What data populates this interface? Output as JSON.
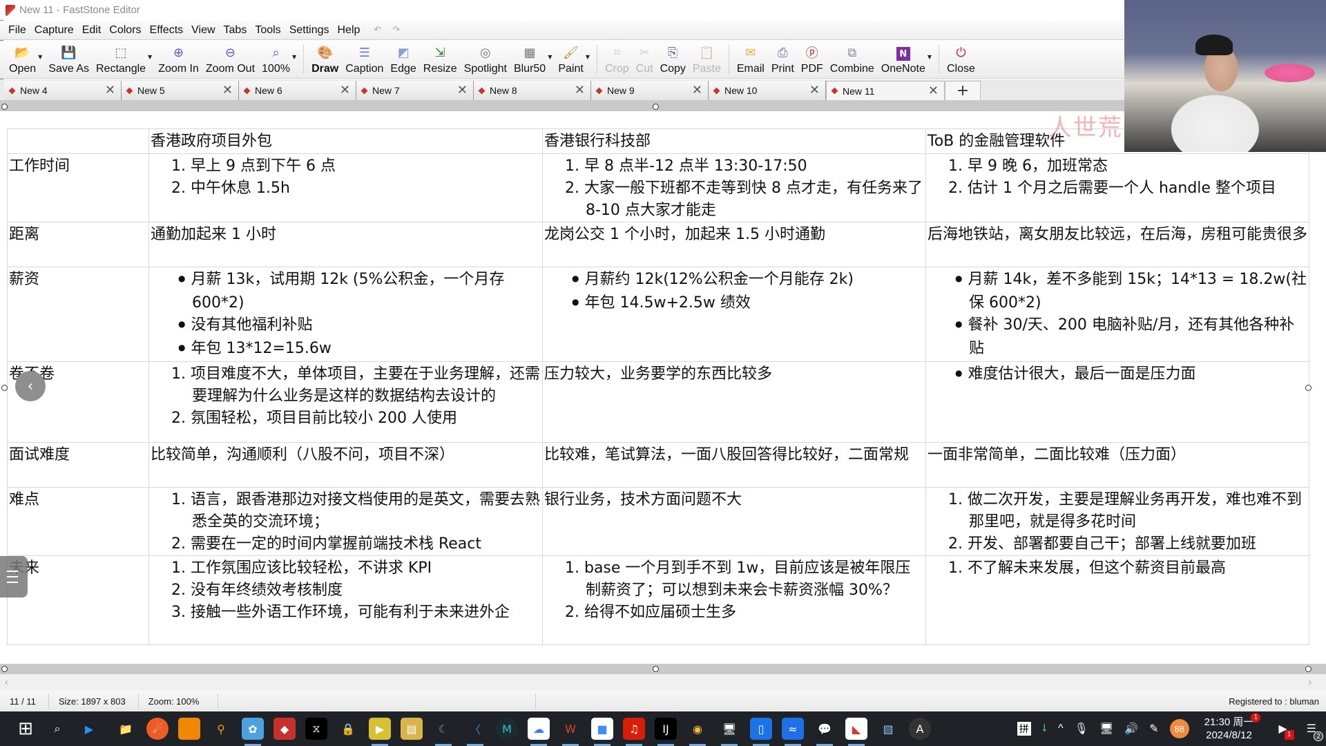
{
  "window": {
    "title": "New 11 - FastStone Editor"
  },
  "menu": {
    "items": [
      "File",
      "Capture",
      "Edit",
      "Colors",
      "Effects",
      "View",
      "Tabs",
      "Tools",
      "Settings",
      "Help"
    ],
    "undo_redo": "↶ ↷"
  },
  "toolbar": {
    "items": [
      {
        "label": "Open",
        "icon": "folder-open-icon",
        "glyph": "📂",
        "dropdown": true
      },
      {
        "label": "Save As",
        "icon": "floppy-disk-icon",
        "glyph": "💾"
      },
      {
        "label": "Rectangle",
        "icon": "rectangle-select-icon",
        "glyph": "⬚",
        "dropdown": true
      },
      {
        "label": "Zoom In",
        "icon": "zoom-in-icon",
        "glyph": "⊕"
      },
      {
        "label": "Zoom Out",
        "icon": "zoom-out-icon",
        "glyph": "⊖"
      },
      {
        "label": "100%",
        "icon": "magnifier-icon",
        "glyph": "⌕",
        "dropdown": true
      },
      {
        "label": "Draw",
        "icon": "draw-palette-icon",
        "glyph": "🎨",
        "bold": true
      },
      {
        "label": "Caption",
        "icon": "caption-icon",
        "glyph": "☰"
      },
      {
        "label": "Edge",
        "icon": "edge-effect-icon",
        "glyph": "◩"
      },
      {
        "label": "Resize",
        "icon": "resize-icon",
        "glyph": "⇲"
      },
      {
        "label": "Spotlight",
        "icon": "spotlight-icon",
        "glyph": "◎"
      },
      {
        "label": "Blur50",
        "icon": "blur-icon",
        "glyph": "▦",
        "dropdown": true
      },
      {
        "label": "Paint",
        "icon": "paint-icon",
        "glyph": "🖌",
        "dropdown": true
      },
      {
        "label": "Crop",
        "icon": "crop-icon",
        "glyph": "⌗",
        "disabled": true
      },
      {
        "label": "Cut",
        "icon": "scissors-icon",
        "glyph": "✂",
        "disabled": true
      },
      {
        "label": "Copy",
        "icon": "copy-icon",
        "glyph": "⎘"
      },
      {
        "label": "Paste",
        "icon": "paste-icon",
        "glyph": "📋",
        "disabled": true
      },
      {
        "label": "Email",
        "icon": "envelope-icon",
        "glyph": "✉"
      },
      {
        "label": "Print",
        "icon": "printer-icon",
        "glyph": "⎙"
      },
      {
        "label": "PDF",
        "icon": "pdf-icon",
        "glyph": "ⓟ"
      },
      {
        "label": "Combine",
        "icon": "combine-icon",
        "glyph": "⧉"
      },
      {
        "label": "OneNote",
        "icon": "onenote-icon",
        "glyph": "N",
        "dropdown": true
      },
      {
        "label": "Close",
        "icon": "power-icon",
        "glyph": "⏻"
      }
    ]
  },
  "tabs": {
    "items": [
      "New 4",
      "New 5",
      "New 6",
      "New 7",
      "New 8",
      "New 9",
      "New 10",
      "New 11"
    ],
    "active": "New 11",
    "add_label": "+",
    "close_glyph": "✕"
  },
  "watermark": "人世荒",
  "table": {
    "headers": [
      "",
      "香港政府项目外包",
      "香港银行科技部",
      "ToB 的金融管理软件"
    ],
    "rows": [
      {
        "label": "工作时间",
        "cells": [
          {
            "type": "ol",
            "items": [
              "早上 9 点到下午 6 点",
              "中午休息 1.5h"
            ]
          },
          {
            "type": "ol",
            "items": [
              "早 8 点半-12 点半 13:30-17:50",
              "大家一般下班都不走等到快 8 点才走，有任务来了 8-10 点大家才能走"
            ]
          },
          {
            "type": "ol",
            "items": [
              "早 9 晚 6，加班常态",
              "估计 1 个月之后需要一个人 handle 整个项目"
            ]
          }
        ]
      },
      {
        "label": "距离",
        "cells": [
          {
            "type": "text",
            "text": "通勤加起来 1 小时"
          },
          {
            "type": "text",
            "text": "龙岗公交 1 个小时，加起来 1.5 小时通勤"
          },
          {
            "type": "text",
            "text": "后海地铁站，离女朋友比较远，在后海，房租可能贵很多"
          }
        ]
      },
      {
        "label": "薪资",
        "cells": [
          {
            "type": "ul",
            "items": [
              "月薪 13k，试用期 12k (5%公积金，一个月存 600*2)",
              "没有其他福利补贴",
              "年包 13*12=15.6w"
            ]
          },
          {
            "type": "ul",
            "items": [
              "月薪约 12k(12%公积金一个月能存 2k)",
              "年包 14.5w+2.5w 绩效"
            ]
          },
          {
            "type": "ul",
            "items": [
              "月薪 14k，差不多能到 15k；14*13 = 18.2w(社保 600*2)",
              "餐补 30/天、200 电脑补贴/月，还有其他各种补贴"
            ]
          }
        ]
      },
      {
        "label": "卷不卷",
        "cells": [
          {
            "type": "ol",
            "items": [
              "项目难度不大，单体项目，主要在于业务理解，还需要理解为什么业务是这样的数据结构去设计的",
              "氛围轻松，项目目前比较小 200 人使用"
            ]
          },
          {
            "type": "text",
            "text": "压力较大，业务要学的东西比较多"
          },
          {
            "type": "ul",
            "items": [
              "难度估计很大，最后一面是压力面"
            ]
          }
        ]
      },
      {
        "label": "面试难度",
        "cells": [
          {
            "type": "text",
            "text": "比较简单，沟通顺利（八股不问，项目不深）"
          },
          {
            "type": "text",
            "text": "比较难，笔试算法，一面八股回答得比较好，二面常规"
          },
          {
            "type": "text",
            "text": "一面非常简单，二面比较难（压力面）"
          }
        ]
      },
      {
        "label": "难点",
        "cells": [
          {
            "type": "ol",
            "items": [
              "语言，跟香港那边对接文档使用的是英文，需要去熟悉全英的交流环境；",
              "需要在一定的时间内掌握前端技术栈 React"
            ]
          },
          {
            "type": "text",
            "text": "银行业务，技术方面问题不大"
          },
          {
            "type": "ol",
            "items": [
              "做二次开发，主要是理解业务再开发，难也难不到那里吧，就是得多花时间",
              "开发、部署都要自己干；部署上线就要加班"
            ]
          }
        ]
      },
      {
        "label": "未来",
        "cells": [
          {
            "type": "ol",
            "items": [
              "工作氛围应该比较轻松，不讲求 KPI",
              "没有年终绩效考核制度",
              "接触一些外语工作环境，可能有利于未来进外企"
            ]
          },
          {
            "type": "ol",
            "items": [
              "base 一个月到手不到 1w，目前应该是被年限压制薪资了；可以想到未来会卡薪资涨幅 30%？",
              "给得不如应届硕士生多"
            ]
          },
          {
            "type": "ol",
            "items": [
              "不了解未来发展，但这个薪资目前最高"
            ]
          }
        ]
      }
    ]
  },
  "overlays": {
    "back_glyph": "‹"
  },
  "status": {
    "page": "11 / 11",
    "size": "Size: 1897 x 803",
    "zoom": "Zoom: 100%",
    "registered": "Registered to : bluman"
  },
  "taskbar": {
    "apps": [
      {
        "name": "start-icon",
        "glyph": "⊞",
        "bg": "transparent"
      },
      {
        "name": "search-icon",
        "glyph": "⌕",
        "bg": "transparent"
      },
      {
        "name": "media-player-icon",
        "glyph": "▶",
        "bg": "transparent",
        "color": "#1e90ff"
      },
      {
        "name": "file-explorer-icon",
        "glyph": "📁",
        "bg": "transparent"
      },
      {
        "name": "postman-icon",
        "glyph": "☄",
        "bg": "#ef5b25",
        "round": true
      },
      {
        "name": "drawio-icon",
        "glyph": "⮖",
        "bg": "#f08705"
      },
      {
        "name": "everything-search-icon",
        "glyph": "⚲",
        "bg": "transparent",
        "color": "#f39c12"
      },
      {
        "name": "live2d-icon",
        "glyph": "✿",
        "bg": "#4aa3df",
        "running": true
      },
      {
        "name": "redis-icon",
        "glyph": "◆",
        "bg": "#c9302c"
      },
      {
        "name": "capcut-icon",
        "glyph": "⧖",
        "bg": "#000"
      },
      {
        "name": "vpn-lock-icon",
        "glyph": "🔒",
        "bg": "transparent"
      },
      {
        "name": "potplayer-icon",
        "glyph": "▶",
        "bg": "#d8c130",
        "running": true
      },
      {
        "name": "winrar-icon",
        "glyph": "▤",
        "bg": "#d9b44a"
      },
      {
        "name": "mysql-dolphin-icon",
        "glyph": "☾",
        "bg": "transparent",
        "color": "#9a8fd8",
        "running": true
      },
      {
        "name": "vscode-icon",
        "glyph": "〈",
        "bg": "transparent",
        "color": "#2c8fe0",
        "running": true
      },
      {
        "name": "markdown-editor-icon",
        "glyph": "M",
        "bg": "#1d2b30",
        "round": true,
        "color": "#2ec4c4"
      },
      {
        "name": "baidu-netdisk-icon",
        "glyph": "☁",
        "bg": "#fff",
        "color": "#3a7bff",
        "running": true
      },
      {
        "name": "wps-icon",
        "glyph": "W",
        "bg": "transparent",
        "color": "#e0402c",
        "running": true
      },
      {
        "name": "files-icon",
        "glyph": "■",
        "bg": "#fff",
        "color": "#3d8bff",
        "running": true
      },
      {
        "name": "netease-music-icon",
        "glyph": "♫",
        "bg": "#d81e06",
        "running": true
      },
      {
        "name": "intellij-icon",
        "glyph": "IJ",
        "bg": "#000",
        "running": true
      },
      {
        "name": "chrome-icon",
        "glyph": "◉",
        "bg": "transparent",
        "color": "#fbc02d",
        "running": true
      },
      {
        "name": "remote-desktop-icon",
        "glyph": "🖥",
        "bg": "transparent",
        "running": true
      },
      {
        "name": "phone-link-icon",
        "glyph": "▯",
        "bg": "#1a73e8",
        "running": true
      },
      {
        "name": "lark-icon",
        "glyph": "≈",
        "bg": "#1f6fe8",
        "running": true
      },
      {
        "name": "wechat-icon",
        "glyph": "💬",
        "bg": "transparent",
        "color": "#2dc100",
        "running": true
      },
      {
        "name": "faststone-capture-icon",
        "glyph": "◣",
        "bg": "#fff",
        "color": "#d33",
        "running": true
      },
      {
        "name": "notepad-icon",
        "glyph": "▧",
        "bg": "transparent",
        "color": "#8fc4e8"
      },
      {
        "name": "astar-icon",
        "glyph": "A",
        "bg": "#333",
        "round": true
      }
    ],
    "tray": {
      "ime": "拼",
      "usb_glyph": "⭣",
      "chevron_glyph": "^",
      "mic_glyph": "🎙",
      "network_glyph": "🖥",
      "volume_glyph": "🔊",
      "pen_glyph": "✎",
      "cpu_temp": "88",
      "time": "21:30 周一",
      "date": "2024/8/12",
      "clock_badge": "1",
      "record_badge": "1",
      "notifications_count": "2"
    }
  }
}
